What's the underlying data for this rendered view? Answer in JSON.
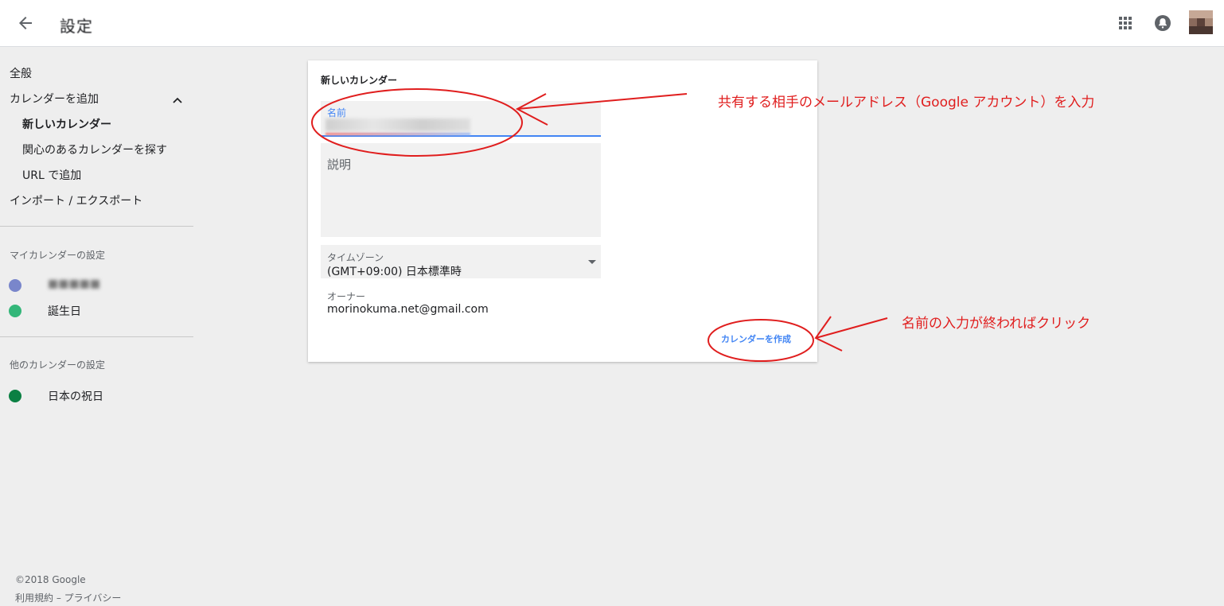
{
  "header": {
    "title": "設定",
    "back_icon": "arrow-back-icon",
    "apps_icon": "apps-grid-icon",
    "notifications_icon": "notification-bell-icon"
  },
  "sidebar": {
    "general": "全般",
    "add_calendar": "カレンダーを追加",
    "add_items": [
      "新しいカレンダー",
      "関心のあるカレンダーを探す",
      "URL で追加"
    ],
    "import_export": "インポート / エクスポート",
    "my_calendars_header": "マイカレンダーの設定",
    "my_calendars": [
      {
        "label": "■■■■■",
        "color": "#7986cb"
      },
      {
        "label": "誕生日",
        "color": "#33b679"
      }
    ],
    "other_calendars_header": "他のカレンダーの設定",
    "other_calendars": [
      {
        "label": "日本の祝日",
        "color": "#0b8043"
      }
    ]
  },
  "footer": {
    "copyright": "©2018 Google",
    "terms": "利用規約",
    "separator": " – ",
    "privacy": "プライバシー"
  },
  "card": {
    "title": "新しいカレンダー",
    "name_label": "名前",
    "description_placeholder": "説明",
    "timezone_label": "タイムゾーン",
    "timezone_value": "(GMT+09:00) 日本標準時",
    "owner_label": "オーナー",
    "owner_value": "morinokuma.net@gmail.com",
    "create_button": "カレンダーを作成"
  },
  "annotations": {
    "name_hint": "共有する相手のメールアドレス（Google アカウント）を入力",
    "create_hint": "名前の入力が終わればクリック",
    "color": "#e01e1e"
  },
  "colors": {
    "accent": "#4285f4",
    "background": "#eeeeee"
  }
}
